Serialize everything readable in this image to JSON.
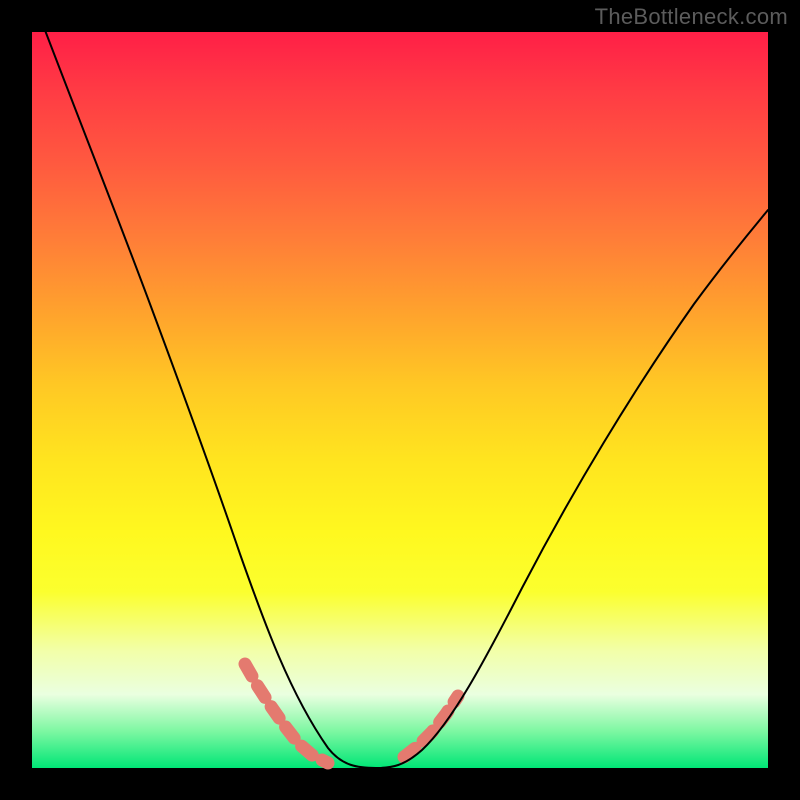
{
  "watermark": "TheBottleneck.com",
  "chart_data": {
    "type": "line",
    "title": "",
    "xlabel": "",
    "ylabel": "",
    "xlim": [
      0,
      1
    ],
    "ylim": [
      0,
      1
    ],
    "series": [
      {
        "name": "bottleneck-curve",
        "x": [
          0.0,
          0.04,
          0.08,
          0.12,
          0.16,
          0.2,
          0.24,
          0.28,
          0.31,
          0.34,
          0.37,
          0.4,
          0.44,
          0.48,
          0.52,
          0.56,
          0.6,
          0.66,
          0.72,
          0.8,
          0.9,
          1.0
        ],
        "values": [
          1.05,
          0.9,
          0.76,
          0.63,
          0.51,
          0.4,
          0.3,
          0.21,
          0.14,
          0.08,
          0.04,
          0.01,
          0.0,
          0.0,
          0.02,
          0.06,
          0.12,
          0.22,
          0.33,
          0.47,
          0.62,
          0.74
        ]
      }
    ],
    "highlight_segments": [
      {
        "name": "left-arm",
        "x_range": [
          0.29,
          0.41
        ],
        "style": "dashed-salmon"
      },
      {
        "name": "right-arm",
        "x_range": [
          0.5,
          0.58
        ],
        "style": "dashed-salmon"
      }
    ],
    "gradient_stops": [
      {
        "pos": 0.0,
        "color": "#ff1f47"
      },
      {
        "pos": 0.18,
        "color": "#ff5a3f"
      },
      {
        "pos": 0.38,
        "color": "#ffa22d"
      },
      {
        "pos": 0.58,
        "color": "#ffe41f"
      },
      {
        "pos": 0.76,
        "color": "#fbff2e"
      },
      {
        "pos": 0.9,
        "color": "#eaffe0"
      },
      {
        "pos": 1.0,
        "color": "#00e676"
      }
    ]
  }
}
